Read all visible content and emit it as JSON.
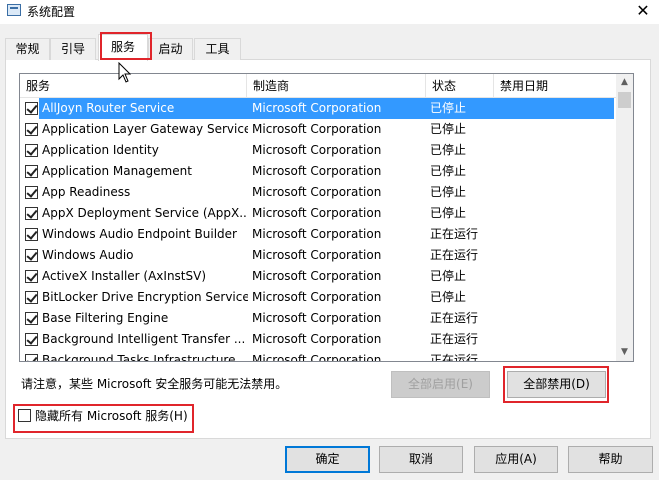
{
  "window": {
    "title": "系统配置",
    "close_glyph": "✕",
    "icon": "msconfig-icon"
  },
  "tabs": [
    {
      "label": "常规",
      "active": false
    },
    {
      "label": "引导",
      "active": false
    },
    {
      "label": "服务",
      "active": true
    },
    {
      "label": "启动",
      "active": false
    },
    {
      "label": "工具",
      "active": false
    }
  ],
  "services": {
    "columns": [
      "服务",
      "制造商",
      "状态",
      "禁用日期"
    ],
    "rows": [
      {
        "name": "AllJoyn Router Service",
        "manufacturer": "Microsoft Corporation",
        "status": "已停止",
        "checked": true,
        "selected": true
      },
      {
        "name": "Application Layer Gateway Service",
        "manufacturer": "Microsoft Corporation",
        "status": "已停止",
        "checked": true
      },
      {
        "name": "Application Identity",
        "manufacturer": "Microsoft Corporation",
        "status": "已停止",
        "checked": true
      },
      {
        "name": "Application Management",
        "manufacturer": "Microsoft Corporation",
        "status": "已停止",
        "checked": true
      },
      {
        "name": "App Readiness",
        "manufacturer": "Microsoft Corporation",
        "status": "已停止",
        "checked": true
      },
      {
        "name": "AppX Deployment Service (AppX...",
        "manufacturer": "Microsoft Corporation",
        "status": "已停止",
        "checked": true
      },
      {
        "name": "Windows Audio Endpoint Builder",
        "manufacturer": "Microsoft Corporation",
        "status": "正在运行",
        "checked": true
      },
      {
        "name": "Windows Audio",
        "manufacturer": "Microsoft Corporation",
        "status": "正在运行",
        "checked": true
      },
      {
        "name": "ActiveX Installer (AxInstSV)",
        "manufacturer": "Microsoft Corporation",
        "status": "已停止",
        "checked": true
      },
      {
        "name": "BitLocker Drive Encryption Service",
        "manufacturer": "Microsoft Corporation",
        "status": "已停止",
        "checked": true
      },
      {
        "name": "Base Filtering Engine",
        "manufacturer": "Microsoft Corporation",
        "status": "正在运行",
        "checked": true
      },
      {
        "name": "Background Intelligent Transfer ...",
        "manufacturer": "Microsoft Corporation",
        "status": "正在运行",
        "checked": true
      },
      {
        "name": "Background Tasks Infrastructure ...",
        "manufacturer": "Microsoft Corporation",
        "status": "正在运行",
        "checked": true
      }
    ]
  },
  "note": "请注意，某些 Microsoft 安全服务可能无法禁用。",
  "enable_all_label": "全部启用(E)",
  "disable_all_label": "全部禁用(D)",
  "hide_ms_label": "隐藏所有 Microsoft 服务(H)",
  "footer": {
    "ok": "确定",
    "cancel": "取消",
    "apply": "应用(A)",
    "help": "帮助"
  },
  "colors": {
    "selection": "#3399ff",
    "highlight_box": "#e0252b",
    "default_button_border": "#0078d7"
  }
}
